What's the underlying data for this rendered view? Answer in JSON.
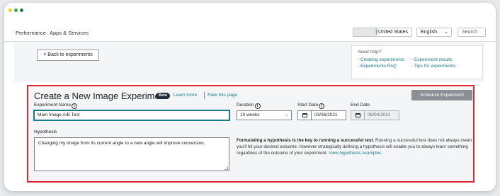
{
  "colors": {
    "dot_yellow": "#f3c623",
    "dot_green": "#3aa757",
    "dot_teal": "#1e7b5a",
    "accent": "#1a7a8a",
    "highlight_border": "#e0262c"
  },
  "nav": {
    "performance": "Performance",
    "apps_services": "Apps & Services",
    "country": "| United States",
    "language": "English",
    "search": "Search"
  },
  "back_button": "< Back to experiments",
  "help": {
    "title": "Need help?",
    "links": [
      "- Creating experiments",
      "- Experiment results",
      "- Experiments FAQ",
      "- Tips for experiments"
    ]
  },
  "form": {
    "title": "Create a New Image Experiment",
    "beta": "Beta",
    "learn_more": "Learn more",
    "rate_page": "Rate this page",
    "schedule_button": "Schedule Experiment",
    "experiment_name_label": "Experiment Name",
    "experiment_name_value": "Main Image A/B Test",
    "duration_label": "Duration",
    "duration_value": "10 weeks",
    "start_date_label": "Start Date",
    "start_date_value": "03/26/2021",
    "end_date_label": "End Date",
    "end_date_value": "06/04/2021",
    "hypothesis_label": "Hypothesis",
    "hypothesis_value": "Changing my image from its current angle to a new angle will improve conversion.",
    "desc_bold": "Formulating a hypothesis is the key to running a successful test.",
    "desc_text": " Running a successful test does not always mean you'll hit your desired outcome. However strategically defining a hypothesis will enable you to always learn something regardless of the outcome of your experiment.",
    "desc_link": "View hypothesis examples."
  }
}
